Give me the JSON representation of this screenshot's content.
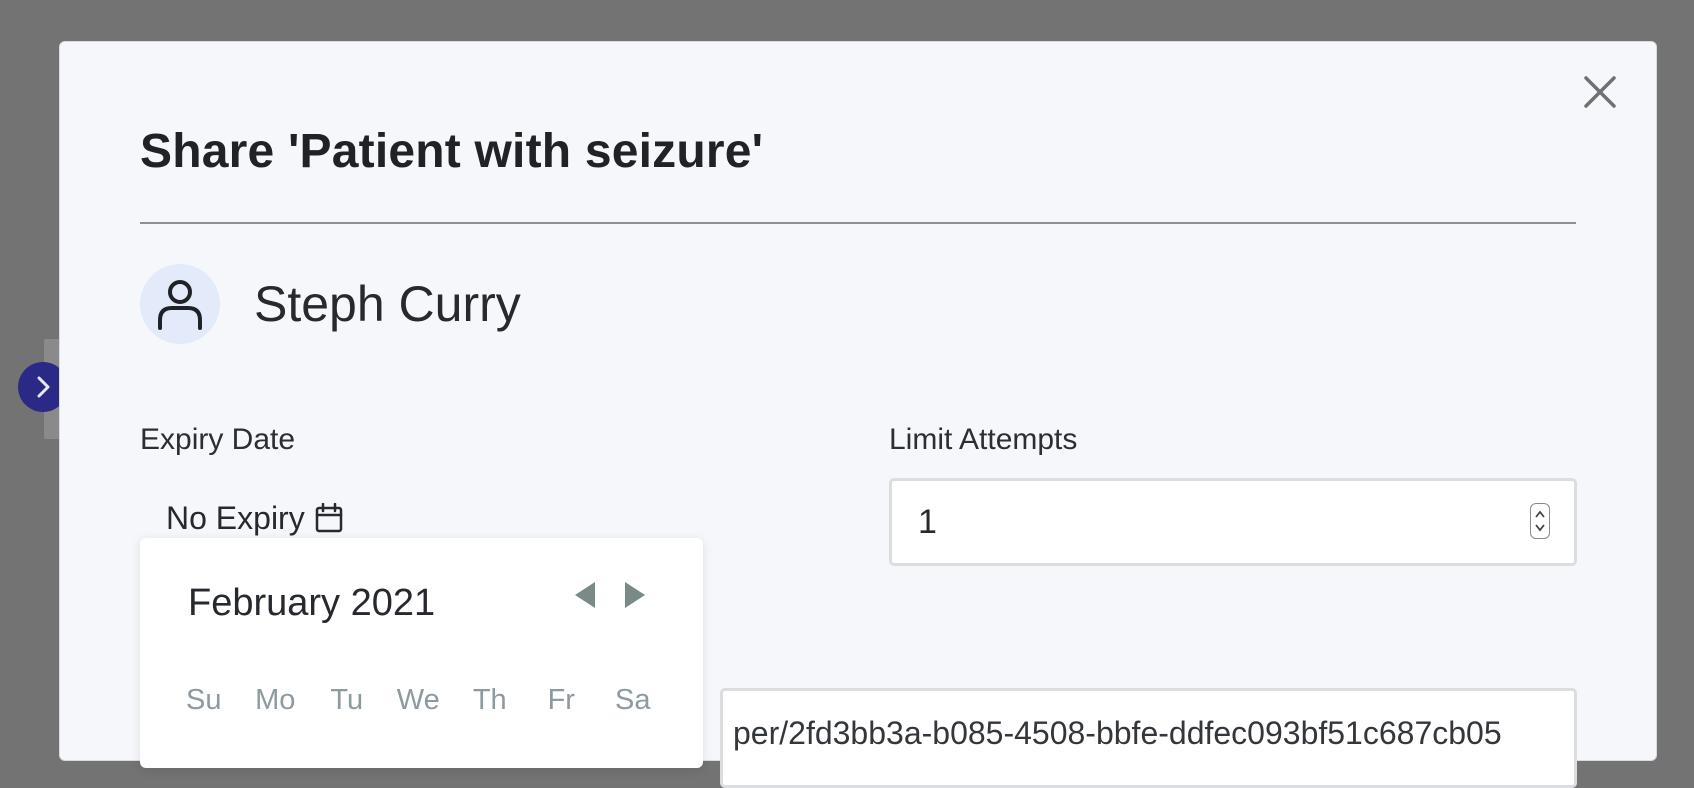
{
  "dialog": {
    "title": "Share 'Patient with seizure'",
    "close_icon": "close-icon"
  },
  "user": {
    "name": "Steph Curry",
    "avatar_icon": "user-icon"
  },
  "expiry": {
    "label": "Expiry Date",
    "value": "No Expiry",
    "icon": "calendar-icon"
  },
  "attempts": {
    "label": "Limit Attempts",
    "value": "1"
  },
  "share_link": {
    "visible_text": "per/2fd3bb3a-b085-4508-bbfe-ddfec093bf51c687cb05"
  },
  "calendar": {
    "month": "February 2021",
    "weekdays": [
      "Su",
      "Mo",
      "Tu",
      "We",
      "Th",
      "Fr",
      "Sa"
    ]
  },
  "sidebar": {
    "toggle_icon": "chevron-right-icon"
  },
  "colors": {
    "backdrop": "#737373",
    "modal_bg": "#f5f7fb",
    "avatar_bg": "#e3ebfb",
    "sidebar_toggle": "#2a2a86",
    "weekday_text": "#8d9aa0"
  }
}
